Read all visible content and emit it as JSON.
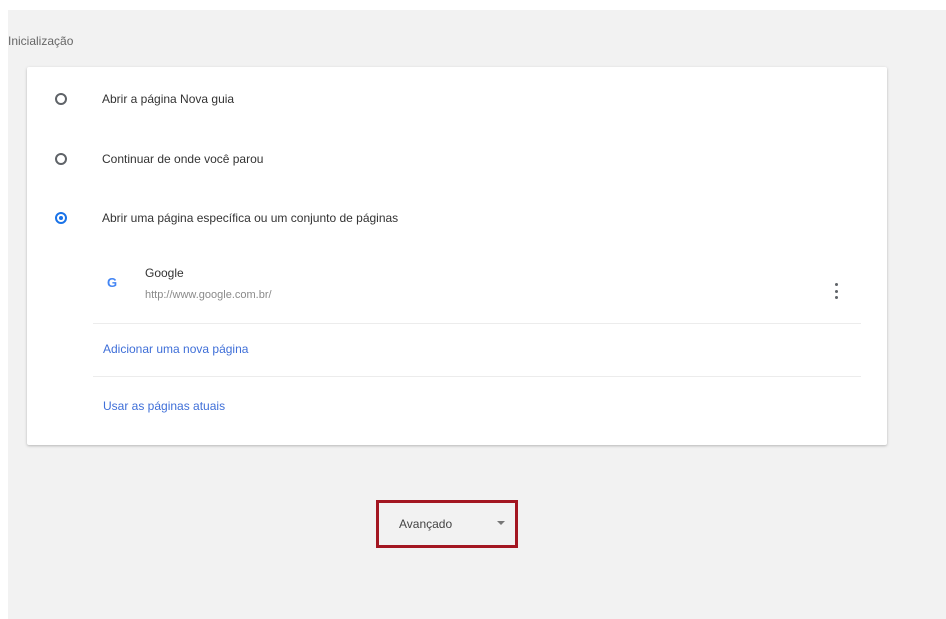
{
  "section": {
    "title": "Inicialização"
  },
  "startup_options": [
    {
      "label": "Abrir a página Nova guia",
      "checked": false
    },
    {
      "label": "Continuar de onde você parou",
      "checked": false
    },
    {
      "label": "Abrir uma página específica ou um conjunto de páginas",
      "checked": true
    }
  ],
  "site": {
    "icon": "google-g-icon",
    "name": "Google",
    "url": "http://www.google.com.br/"
  },
  "links": {
    "add_page": "Adicionar uma nova página",
    "use_current": "Usar as páginas atuais"
  },
  "advanced": {
    "label": "Avançado",
    "icon": "chevron-down-icon"
  },
  "colors": {
    "accent": "#1a73e8",
    "link": "#3f6fd8",
    "highlight_border": "#a31621",
    "background": "#f2f2f2"
  }
}
